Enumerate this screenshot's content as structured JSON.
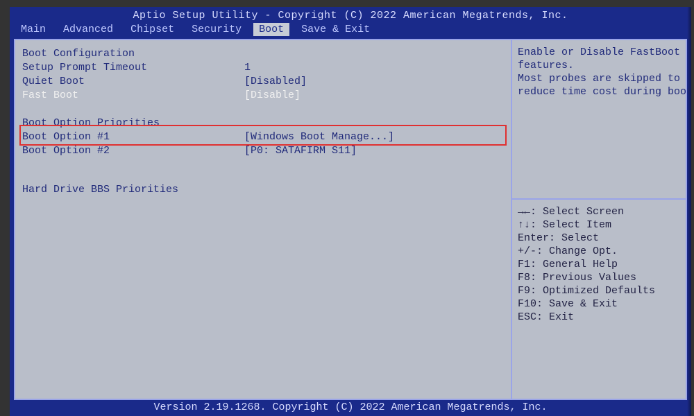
{
  "header": {
    "title": "Aptio Setup Utility - Copyright (C) 2022 American Megatrends, Inc.",
    "tabs": [
      "Main",
      "Advanced",
      "Chipset",
      "Security",
      "Boot",
      "Save & Exit"
    ],
    "active_tab_index": 4
  },
  "boot": {
    "section1_title": "Boot Configuration",
    "setup_prompt_timeout": {
      "label": "Setup Prompt Timeout",
      "value": "1"
    },
    "quiet_boot": {
      "label": "Quiet Boot",
      "value": "[Disabled]"
    },
    "fast_boot": {
      "label": "Fast Boot",
      "value": "[Disable]",
      "selected": true
    },
    "section2_title": "Boot Option Priorities",
    "option1": {
      "label": "Boot Option #1",
      "value": "[Windows Boot Manage...]"
    },
    "option2": {
      "label": "Boot Option #2",
      "value": "[P0: SATAFIRM   S11]"
    },
    "hdd_bbs_label": "Hard Drive BBS Priorities"
  },
  "help": {
    "line1": "Enable or Disable FastBoot",
    "line2": "features.",
    "line3": " Most probes are skipped to",
    "line4": "reduce time cost during boot."
  },
  "keys": {
    "k0": "→←: Select Screen",
    "k1": "↑↓: Select Item",
    "k2": "Enter: Select",
    "k3": "+/-: Change Opt.",
    "k4": "F1: General Help",
    "k5": "F8: Previous Values",
    "k6": "F9: Optimized Defaults",
    "k7": "F10: Save & Exit",
    "k8": "ESC: Exit"
  },
  "footer": {
    "text": "Version 2.19.1268. Copyright (C) 2022 American Megatrends, Inc."
  }
}
